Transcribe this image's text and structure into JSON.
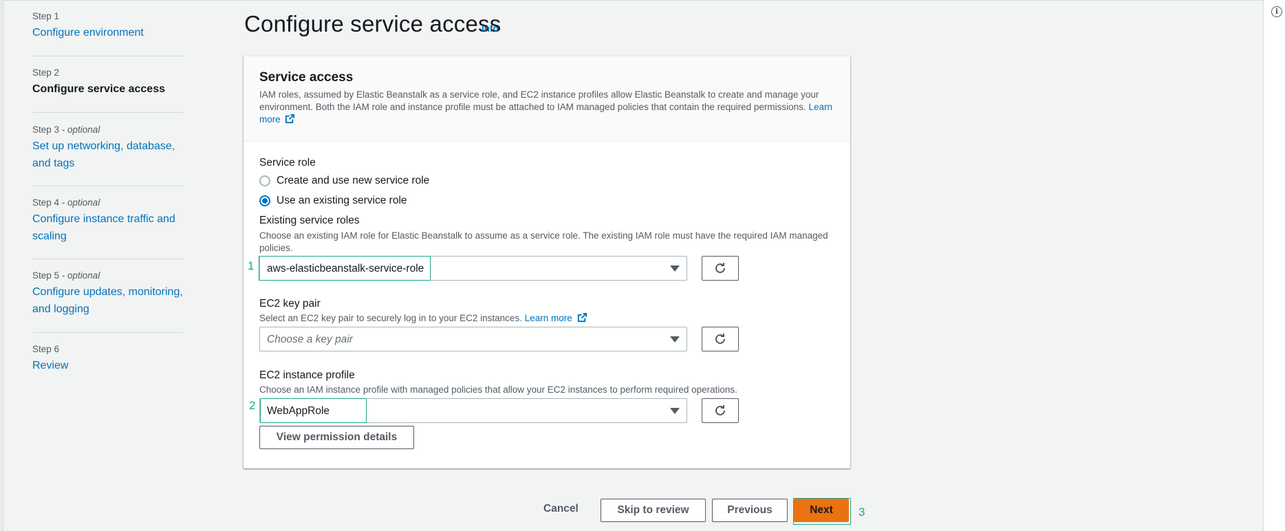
{
  "steps": [
    {
      "num": "Step 1",
      "optional": "",
      "label": "Configure environment",
      "current": false
    },
    {
      "num": "Step 2",
      "optional": "",
      "label": "Configure service access",
      "current": true
    },
    {
      "num": "Step 3",
      "optional": " - optional",
      "label": "Set up networking, database, and tags",
      "current": false
    },
    {
      "num": "Step 4",
      "optional": " - optional",
      "label": "Configure instance traffic and scaling",
      "current": false
    },
    {
      "num": "Step 5",
      "optional": " - optional",
      "label": "Configure updates, monitoring, and logging",
      "current": false
    },
    {
      "num": "Step 6",
      "optional": "",
      "label": "Review",
      "current": false
    }
  ],
  "page": {
    "title": "Configure service access",
    "info": "Info"
  },
  "card": {
    "title": "Service access",
    "description": "IAM roles, assumed by Elastic Beanstalk as a service role, and EC2 instance profiles allow Elastic Beanstalk to create and manage your environment. Both the IAM role and instance profile must be attached to IAM managed policies that contain the required permissions.",
    "learn_more": "Learn more"
  },
  "service_role": {
    "label": "Service role",
    "options": [
      {
        "label": "Create and use new service role",
        "checked": false
      },
      {
        "label": "Use an existing service role",
        "checked": true
      }
    ]
  },
  "existing_roles": {
    "label": "Existing service roles",
    "description": "Choose an existing IAM role for Elastic Beanstalk to assume as a service role. The existing IAM role must have the required IAM managed policies.",
    "value": "aws-elasticbeanstalk-service-role",
    "marker": "1"
  },
  "key_pair": {
    "label": "EC2 key pair",
    "description": "Select an EC2 key pair to securely log in to your EC2 instances.",
    "learn_more": "Learn more",
    "placeholder": "Choose a key pair"
  },
  "instance_profile": {
    "label": "EC2 instance profile",
    "description": "Choose an IAM instance profile with managed policies that allow your EC2 instances to perform required operations.",
    "value": "WebAppRole",
    "marker": "2"
  },
  "view_permissions_label": "View permission details",
  "footer": {
    "cancel": "Cancel",
    "skip": "Skip to review",
    "previous": "Previous",
    "next": "Next",
    "marker": "3"
  },
  "colors": {
    "link": "#0073bb",
    "primary": "#ec7211",
    "highlight": "#1aa789"
  },
  "icons": [
    "info-icon",
    "external-link-icon",
    "caret-down-icon",
    "refresh-icon"
  ]
}
